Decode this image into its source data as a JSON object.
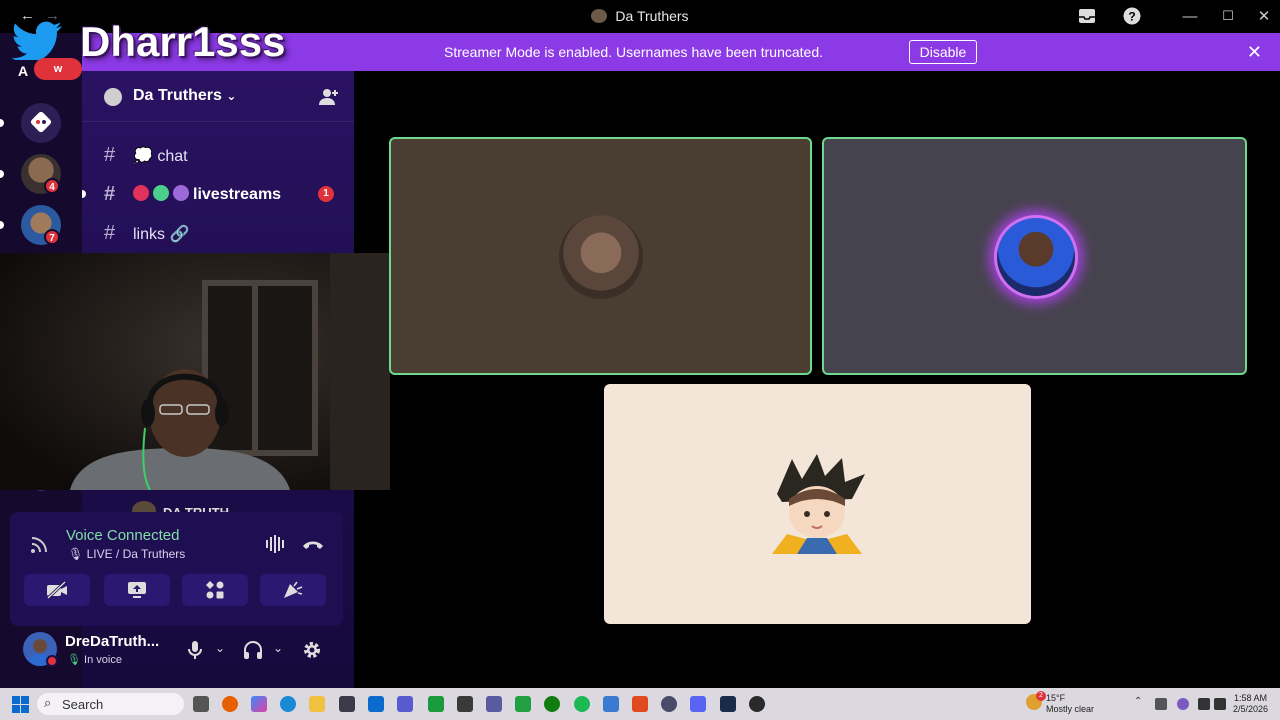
{
  "window": {
    "title": "Da Truthers"
  },
  "overlay": {
    "brand_name": "Dharr1sss",
    "badge_text": "w"
  },
  "banner": {
    "text": "Streamer Mode is enabled. Usernames have been truncated.",
    "button_label": "Disable",
    "close_glyph": "✕"
  },
  "rail": {
    "top_label": "A",
    "badges": [
      "4",
      "7"
    ]
  },
  "server": {
    "name": "Da Truthers"
  },
  "channels": [
    {
      "name": "💭 chat",
      "hash": "#"
    },
    {
      "name": "livestreams",
      "hash": "#",
      "badge": "1"
    },
    {
      "name": "links 🔗",
      "hash": "#"
    }
  ],
  "voice": {
    "status": "Voice Connected",
    "location": "LIVE / Da Truthers"
  },
  "user": {
    "name": "DreDaTruth...",
    "status": "In voice"
  },
  "partial_member_text": "DA TRUTH",
  "taskbar": {
    "search_label": "Search",
    "weather_temp": "15°F",
    "weather_desc": "Mostly clear",
    "time": "1:58 AM",
    "date": "2/5/2026",
    "weather_badge": "2"
  },
  "colors": {
    "banner": "#8c39e6",
    "rail": "#150a2e",
    "voice_green": "#7fe0a5",
    "speaking_border": "#6fd88c",
    "tile1_bg": "#4a3d32",
    "tile2_bg": "#45434d",
    "tile3_bg": "#f3e6d8"
  }
}
